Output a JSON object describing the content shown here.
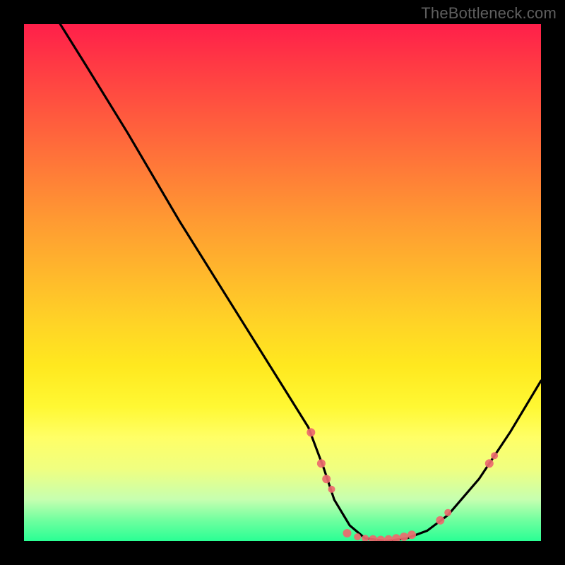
{
  "watermark": "TheBottleneck.com",
  "chart_data": {
    "type": "line",
    "title": "",
    "xlabel": "",
    "ylabel": "",
    "xlim": [
      0,
      100
    ],
    "ylim": [
      0,
      100
    ],
    "series": [
      {
        "name": "curve",
        "x": [
          7,
          12,
          20,
          30,
          40,
          50,
          55,
          58,
          60,
          63,
          66,
          70,
          74,
          78,
          82,
          88,
          94,
          100
        ],
        "values": [
          100,
          92,
          79,
          62,
          46,
          30,
          22,
          14,
          8,
          3,
          0.5,
          0,
          0.5,
          2,
          5,
          12,
          21,
          31
        ]
      }
    ],
    "markers": [
      {
        "x": 55.5,
        "y": 21,
        "r": 6
      },
      {
        "x": 57.5,
        "y": 15,
        "r": 6
      },
      {
        "x": 58.5,
        "y": 12,
        "r": 6
      },
      {
        "x": 59.5,
        "y": 10,
        "r": 5
      },
      {
        "x": 62.5,
        "y": 1.5,
        "r": 6
      },
      {
        "x": 64.5,
        "y": 0.8,
        "r": 5
      },
      {
        "x": 66,
        "y": 0.5,
        "r": 5
      },
      {
        "x": 67.5,
        "y": 0.3,
        "r": 6
      },
      {
        "x": 69,
        "y": 0.2,
        "r": 6
      },
      {
        "x": 70.5,
        "y": 0.3,
        "r": 6
      },
      {
        "x": 72,
        "y": 0.5,
        "r": 6
      },
      {
        "x": 73.5,
        "y": 0.8,
        "r": 6
      },
      {
        "x": 75,
        "y": 1.2,
        "r": 6
      },
      {
        "x": 80.5,
        "y": 4,
        "r": 6
      },
      {
        "x": 82,
        "y": 5.5,
        "r": 5
      },
      {
        "x": 90,
        "y": 15,
        "r": 6
      },
      {
        "x": 91,
        "y": 16.5,
        "r": 5
      }
    ],
    "gradient_stops": [
      {
        "pos": 0,
        "color": "#ff1f4a"
      },
      {
        "pos": 50,
        "color": "#ffc828"
      },
      {
        "pos": 80,
        "color": "#ffff66"
      },
      {
        "pos": 100,
        "color": "#2aff94"
      }
    ]
  }
}
